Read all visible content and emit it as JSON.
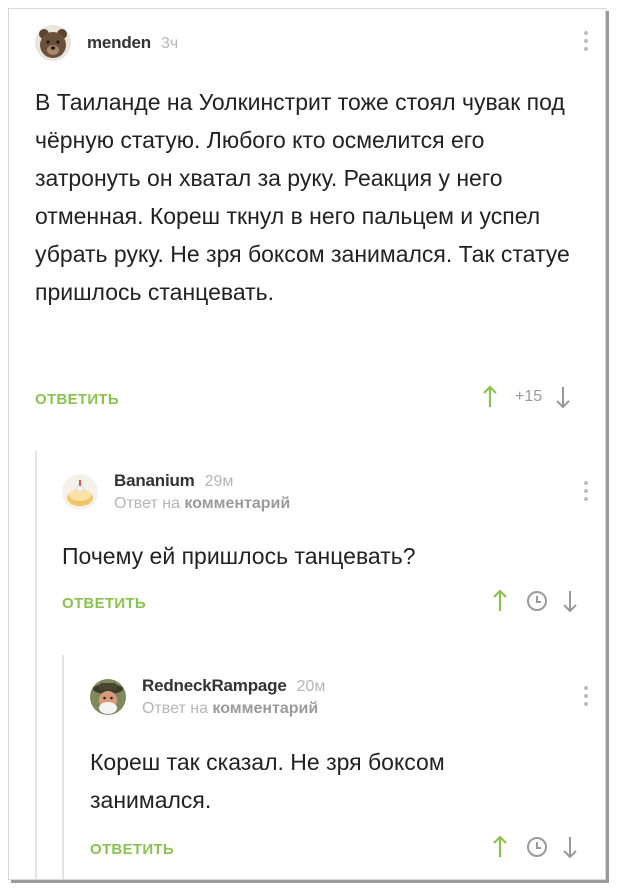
{
  "comments": [
    {
      "author": "menden",
      "time": "3ч",
      "text": "В Таиланде на Уолкинстрит тоже стоял чувак под чёрную статую. Любого кто осмелится его затронуть он хватал за руку. Реакция у него отменная. Кореш ткнул в него пальцем и успел убрать руку. Не зря боксом занимался. Так статуе пришлось станцевать.",
      "reply_label": "ОТВЕТИТЬ",
      "score": "+15"
    },
    {
      "author": "Bananium",
      "time": "29м",
      "reply_to_prefix": "Ответ на",
      "reply_to_link": "комментарий",
      "text": "Почему ей пришлось танцевать?",
      "reply_label": "ОТВЕТИТЬ"
    },
    {
      "author": "RedneckRampage",
      "time": "20м",
      "reply_to_prefix": "Ответ на",
      "reply_to_link": "комментарий",
      "text": "Кореш так сказал. Не зря боксом занимался.",
      "reply_label": "ОТВЕТИТЬ"
    }
  ],
  "colors": {
    "accent_green": "#8cc152",
    "muted_gray": "#b5b5b5"
  },
  "icons": {
    "upvote": "arrow-up-icon",
    "downvote": "arrow-down-icon",
    "more": "more-vertical-icon",
    "pending": "clock-icon"
  }
}
